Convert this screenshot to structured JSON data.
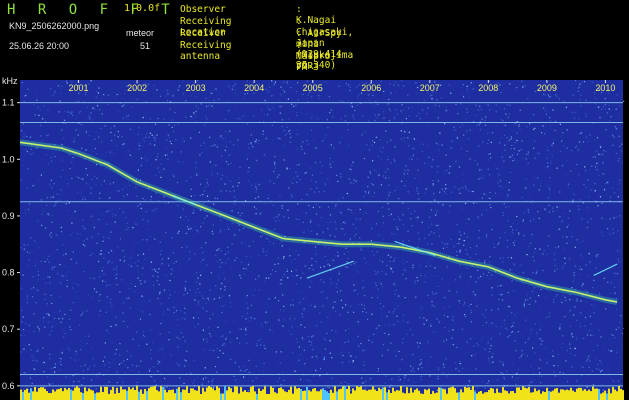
{
  "app": {
    "name": "H R O F F T",
    "version": "1.0.0f",
    "filename": "KN9_2506262000.png",
    "mode": "meteor",
    "datetime": "25.06.26 20:00",
    "count": "51"
  },
  "info": [
    {
      "key": "Observer",
      "value": ": K.Nagai"
    },
    {
      "key": "Receiving Location",
      "value": ": Chigasaki, Japan (139.414 35.340)"
    },
    {
      "key": "Receiver",
      "value": ": AirSpy mini (Miakejima VOR 108.65MHz)"
    },
    {
      "key": "Receiving antenna",
      "value": ": Maspro FM-3"
    }
  ],
  "colors": {
    "background": "#1e2ea0",
    "accent_green": "#8fe03a",
    "accent_yellow": "#e8e82a"
  },
  "chart_data": {
    "type": "heatmap",
    "ylabel": "kHz",
    "x_tick_labels": [
      "2001",
      "2002",
      "2003",
      "2004",
      "2005",
      "2006",
      "2007",
      "2008",
      "2009",
      "2010"
    ],
    "y_tick_labels": [
      "1.1",
      "1.0",
      "0.9",
      "0.8",
      "0.7",
      "0.6"
    ],
    "ylim": [
      0.575,
      1.14
    ],
    "trace": {
      "x": [
        2000.0,
        2000.7,
        2001.0,
        2001.5,
        2002.0,
        2002.5,
        2003.0,
        2003.5,
        2004.0,
        2004.5,
        2005.0,
        2005.5,
        2006.0,
        2006.5,
        2007.0,
        2007.5,
        2008.0,
        2008.5,
        2009.0,
        2009.5,
        2010.0,
        2010.2
      ],
      "y": [
        1.03,
        1.02,
        1.01,
        0.99,
        0.96,
        0.94,
        0.92,
        0.9,
        0.88,
        0.86,
        0.855,
        0.85,
        0.85,
        0.845,
        0.835,
        0.82,
        0.81,
        0.79,
        0.775,
        0.765,
        0.752,
        0.748
      ]
    },
    "horizontal_lines": [
      1.1,
      1.065,
      0.925,
      0.62,
      0.6
    ]
  }
}
